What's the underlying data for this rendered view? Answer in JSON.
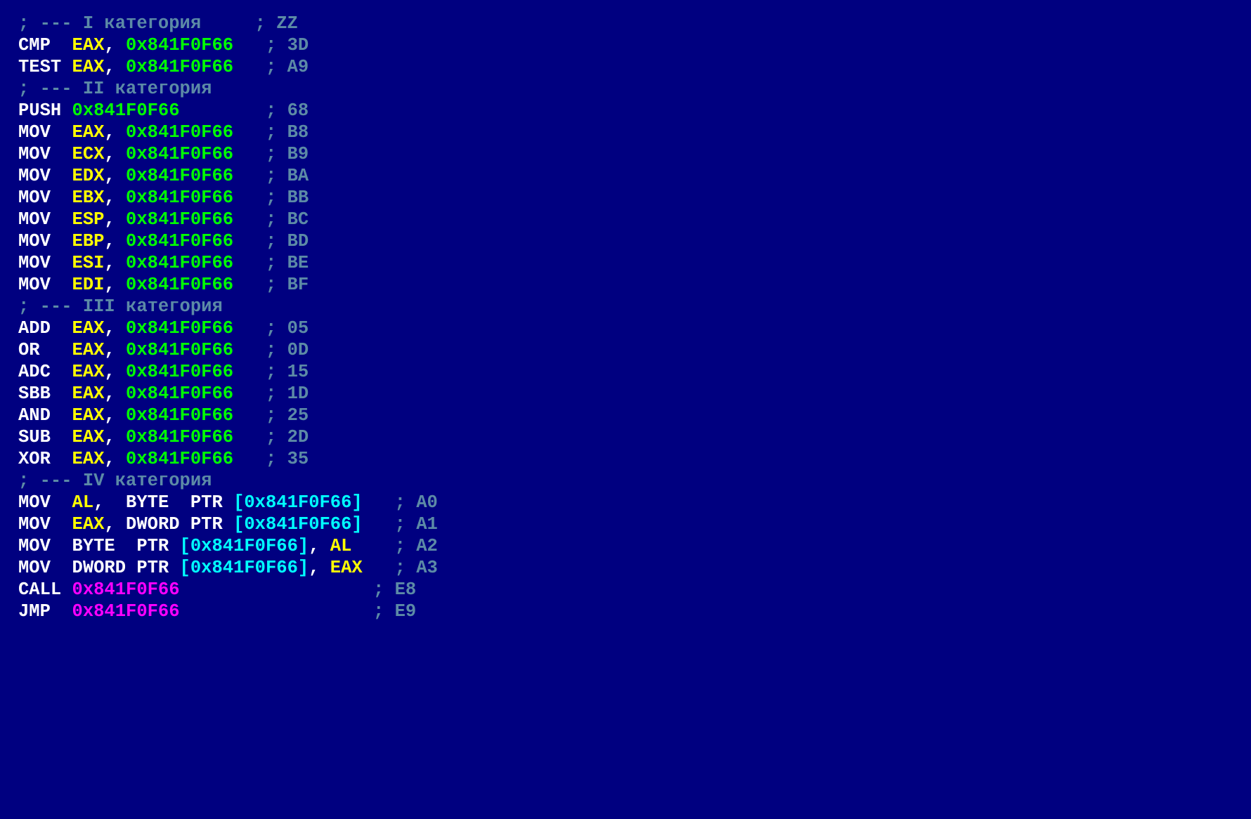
{
  "lines": [
    {
      "seg": [
        {
          "c": "cmt",
          "t": "; --- I категория     ; ZZ"
        }
      ]
    },
    {
      "seg": [
        {
          "c": "op",
          "t": "CMP  "
        },
        {
          "c": "reg",
          "t": "EAX"
        },
        {
          "c": "op",
          "t": ", "
        },
        {
          "c": "imm",
          "t": "0x841F0F66"
        },
        {
          "c": "op",
          "t": "   "
        },
        {
          "c": "cmt",
          "t": "; 3D"
        }
      ]
    },
    {
      "seg": [
        {
          "c": "op",
          "t": "TEST "
        },
        {
          "c": "reg",
          "t": "EAX"
        },
        {
          "c": "op",
          "t": ", "
        },
        {
          "c": "imm",
          "t": "0x841F0F66"
        },
        {
          "c": "op",
          "t": "   "
        },
        {
          "c": "cmt",
          "t": "; A9"
        }
      ]
    },
    {
      "seg": [
        {
          "c": "cmt",
          "t": "; --- II категория"
        }
      ]
    },
    {
      "seg": [
        {
          "c": "op",
          "t": "PUSH "
        },
        {
          "c": "imm",
          "t": "0x841F0F66"
        },
        {
          "c": "op",
          "t": "        "
        },
        {
          "c": "cmt",
          "t": "; 68"
        }
      ]
    },
    {
      "seg": [
        {
          "c": "op",
          "t": "MOV  "
        },
        {
          "c": "reg",
          "t": "EAX"
        },
        {
          "c": "op",
          "t": ", "
        },
        {
          "c": "imm",
          "t": "0x841F0F66"
        },
        {
          "c": "op",
          "t": "   "
        },
        {
          "c": "cmt",
          "t": "; B8"
        }
      ]
    },
    {
      "seg": [
        {
          "c": "op",
          "t": "MOV  "
        },
        {
          "c": "reg",
          "t": "ECX"
        },
        {
          "c": "op",
          "t": ", "
        },
        {
          "c": "imm",
          "t": "0x841F0F66"
        },
        {
          "c": "op",
          "t": "   "
        },
        {
          "c": "cmt",
          "t": "; B9"
        }
      ]
    },
    {
      "seg": [
        {
          "c": "op",
          "t": "MOV  "
        },
        {
          "c": "reg",
          "t": "EDX"
        },
        {
          "c": "op",
          "t": ", "
        },
        {
          "c": "imm",
          "t": "0x841F0F66"
        },
        {
          "c": "op",
          "t": "   "
        },
        {
          "c": "cmt",
          "t": "; BA"
        }
      ]
    },
    {
      "seg": [
        {
          "c": "op",
          "t": "MOV  "
        },
        {
          "c": "reg",
          "t": "EBX"
        },
        {
          "c": "op",
          "t": ", "
        },
        {
          "c": "imm",
          "t": "0x841F0F66"
        },
        {
          "c": "op",
          "t": "   "
        },
        {
          "c": "cmt",
          "t": "; BB"
        }
      ]
    },
    {
      "seg": [
        {
          "c": "op",
          "t": "MOV  "
        },
        {
          "c": "reg",
          "t": "ESP"
        },
        {
          "c": "op",
          "t": ", "
        },
        {
          "c": "imm",
          "t": "0x841F0F66"
        },
        {
          "c": "op",
          "t": "   "
        },
        {
          "c": "cmt",
          "t": "; BC"
        }
      ]
    },
    {
      "seg": [
        {
          "c": "op",
          "t": "MOV  "
        },
        {
          "c": "reg",
          "t": "EBP"
        },
        {
          "c": "op",
          "t": ", "
        },
        {
          "c": "imm",
          "t": "0x841F0F66"
        },
        {
          "c": "op",
          "t": "   "
        },
        {
          "c": "cmt",
          "t": "; BD"
        }
      ]
    },
    {
      "seg": [
        {
          "c": "op",
          "t": "MOV  "
        },
        {
          "c": "reg",
          "t": "ESI"
        },
        {
          "c": "op",
          "t": ", "
        },
        {
          "c": "imm",
          "t": "0x841F0F66"
        },
        {
          "c": "op",
          "t": "   "
        },
        {
          "c": "cmt",
          "t": "; BE"
        }
      ]
    },
    {
      "seg": [
        {
          "c": "op",
          "t": "MOV  "
        },
        {
          "c": "reg",
          "t": "EDI"
        },
        {
          "c": "op",
          "t": ", "
        },
        {
          "c": "imm",
          "t": "0x841F0F66"
        },
        {
          "c": "op",
          "t": "   "
        },
        {
          "c": "cmt",
          "t": "; BF"
        }
      ]
    },
    {
      "seg": [
        {
          "c": "cmt",
          "t": "; --- III категория"
        }
      ]
    },
    {
      "seg": [
        {
          "c": "op",
          "t": "ADD  "
        },
        {
          "c": "reg",
          "t": "EAX"
        },
        {
          "c": "op",
          "t": ", "
        },
        {
          "c": "imm",
          "t": "0x841F0F66"
        },
        {
          "c": "op",
          "t": "   "
        },
        {
          "c": "cmt",
          "t": "; 05"
        }
      ]
    },
    {
      "seg": [
        {
          "c": "op",
          "t": "OR   "
        },
        {
          "c": "reg",
          "t": "EAX"
        },
        {
          "c": "op",
          "t": ", "
        },
        {
          "c": "imm",
          "t": "0x841F0F66"
        },
        {
          "c": "op",
          "t": "   "
        },
        {
          "c": "cmt",
          "t": "; 0D"
        }
      ]
    },
    {
      "seg": [
        {
          "c": "op",
          "t": "ADC  "
        },
        {
          "c": "reg",
          "t": "EAX"
        },
        {
          "c": "op",
          "t": ", "
        },
        {
          "c": "imm",
          "t": "0x841F0F66"
        },
        {
          "c": "op",
          "t": "   "
        },
        {
          "c": "cmt",
          "t": "; 15"
        }
      ]
    },
    {
      "seg": [
        {
          "c": "op",
          "t": "SBB  "
        },
        {
          "c": "reg",
          "t": "EAX"
        },
        {
          "c": "op",
          "t": ", "
        },
        {
          "c": "imm",
          "t": "0x841F0F66"
        },
        {
          "c": "op",
          "t": "   "
        },
        {
          "c": "cmt",
          "t": "; 1D"
        }
      ]
    },
    {
      "seg": [
        {
          "c": "op",
          "t": "AND  "
        },
        {
          "c": "reg",
          "t": "EAX"
        },
        {
          "c": "op",
          "t": ", "
        },
        {
          "c": "imm",
          "t": "0x841F0F66"
        },
        {
          "c": "op",
          "t": "   "
        },
        {
          "c": "cmt",
          "t": "; 25"
        }
      ]
    },
    {
      "seg": [
        {
          "c": "op",
          "t": "SUB  "
        },
        {
          "c": "reg",
          "t": "EAX"
        },
        {
          "c": "op",
          "t": ", "
        },
        {
          "c": "imm",
          "t": "0x841F0F66"
        },
        {
          "c": "op",
          "t": "   "
        },
        {
          "c": "cmt",
          "t": "; 2D"
        }
      ]
    },
    {
      "seg": [
        {
          "c": "op",
          "t": "XOR  "
        },
        {
          "c": "reg",
          "t": "EAX"
        },
        {
          "c": "op",
          "t": ", "
        },
        {
          "c": "imm",
          "t": "0x841F0F66"
        },
        {
          "c": "op",
          "t": "   "
        },
        {
          "c": "cmt",
          "t": "; 35"
        }
      ]
    },
    {
      "seg": [
        {
          "c": "cmt",
          "t": "; --- IV категория"
        }
      ]
    },
    {
      "seg": [
        {
          "c": "op",
          "t": "MOV  "
        },
        {
          "c": "reg",
          "t": "AL"
        },
        {
          "c": "op",
          "t": ",  "
        },
        {
          "c": "kw",
          "t": "BYTE  PTR "
        },
        {
          "c": "br",
          "t": "[0x841F0F66]"
        },
        {
          "c": "op",
          "t": "   "
        },
        {
          "c": "cmt",
          "t": "; A0"
        }
      ]
    },
    {
      "seg": [
        {
          "c": "op",
          "t": "MOV  "
        },
        {
          "c": "reg",
          "t": "EAX"
        },
        {
          "c": "op",
          "t": ", "
        },
        {
          "c": "kw",
          "t": "DWORD PTR "
        },
        {
          "c": "br",
          "t": "[0x841F0F66]"
        },
        {
          "c": "op",
          "t": "   "
        },
        {
          "c": "cmt",
          "t": "; A1"
        }
      ]
    },
    {
      "seg": [
        {
          "c": "op",
          "t": "MOV  "
        },
        {
          "c": "kw",
          "t": "BYTE  PTR "
        },
        {
          "c": "br",
          "t": "[0x841F0F66]"
        },
        {
          "c": "op",
          "t": ", "
        },
        {
          "c": "reg",
          "t": "AL"
        },
        {
          "c": "op",
          "t": "    "
        },
        {
          "c": "cmt",
          "t": "; A2"
        }
      ]
    },
    {
      "seg": [
        {
          "c": "op",
          "t": "MOV  "
        },
        {
          "c": "kw",
          "t": "DWORD PTR "
        },
        {
          "c": "br",
          "t": "[0x841F0F66]"
        },
        {
          "c": "op",
          "t": ", "
        },
        {
          "c": "reg",
          "t": "EAX"
        },
        {
          "c": "op",
          "t": "   "
        },
        {
          "c": "cmt",
          "t": "; A3"
        }
      ]
    },
    {
      "seg": [
        {
          "c": "op",
          "t": "CALL "
        },
        {
          "c": "addr",
          "t": "0x841F0F66"
        },
        {
          "c": "op",
          "t": "                  "
        },
        {
          "c": "cmt",
          "t": "; E8"
        }
      ]
    },
    {
      "seg": [
        {
          "c": "op",
          "t": "JMP  "
        },
        {
          "c": "addr",
          "t": "0x841F0F66"
        },
        {
          "c": "op",
          "t": "                  "
        },
        {
          "c": "cmt",
          "t": "; E9"
        }
      ]
    }
  ]
}
